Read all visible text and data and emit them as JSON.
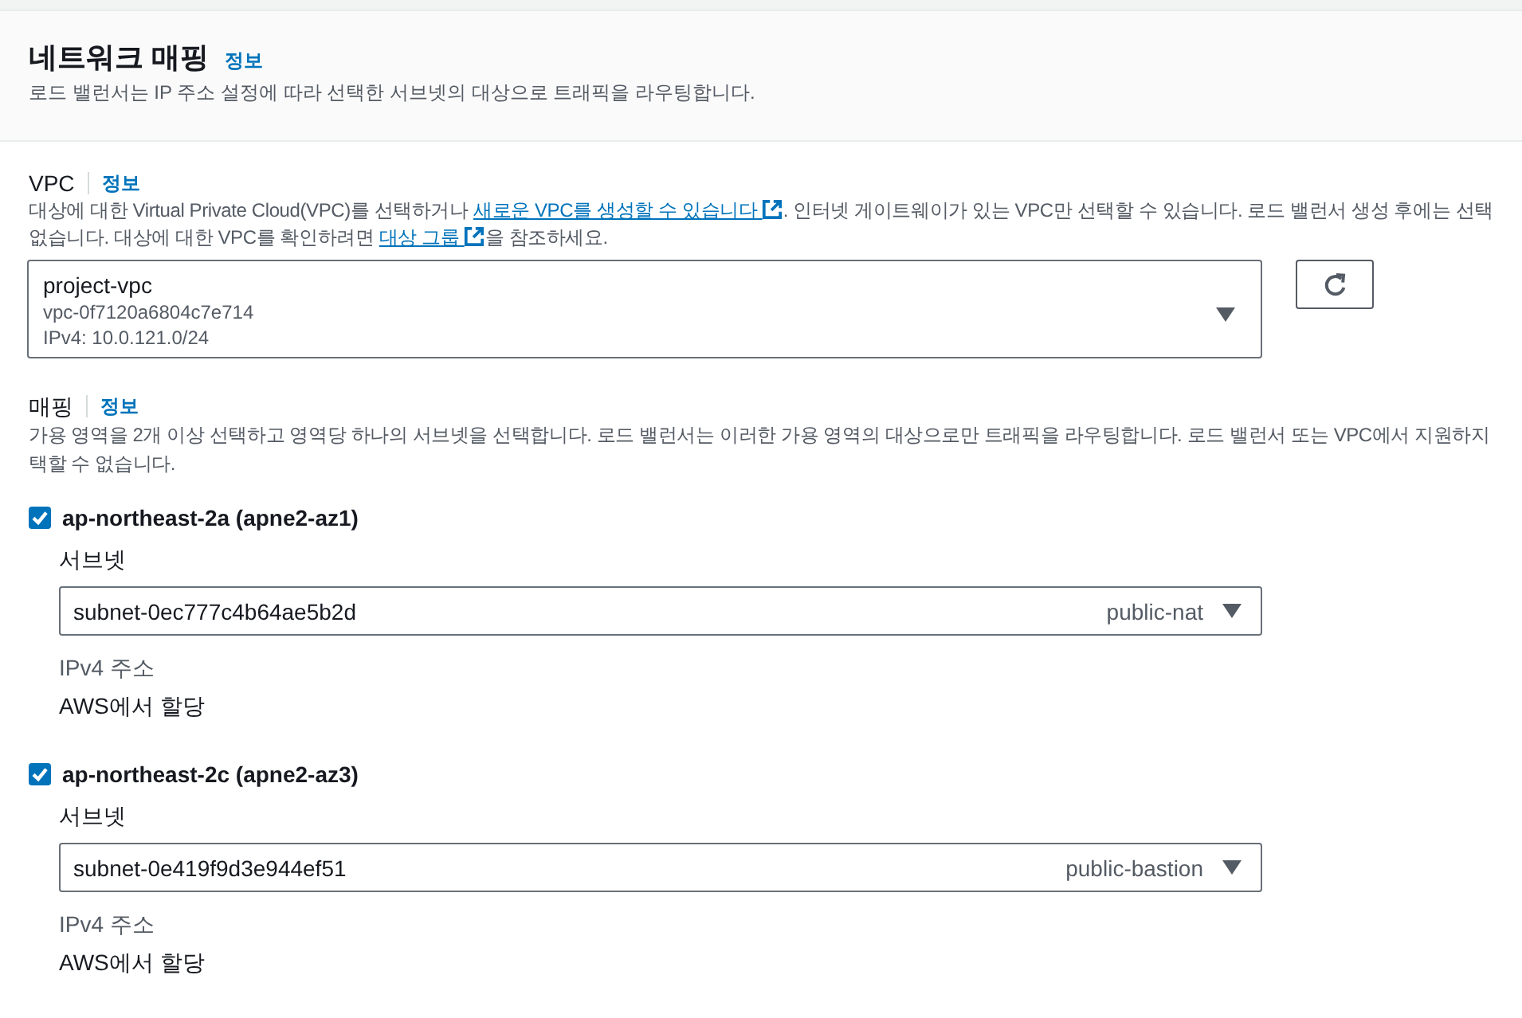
{
  "header": {
    "title": "네트워크 매핑",
    "info_link": "정보",
    "description": "로드 밸런서는 IP 주소 설정에 따라 선택한 서브넷의 대상으로 트래픽을 라우팅합니다."
  },
  "vpc": {
    "label": "VPC",
    "info_link": "정보",
    "description_lines": [
      [
        {
          "kind": "text",
          "text": "대상에 대한 Virtual Private Cloud(VPC)를 선택하거나 "
        },
        {
          "kind": "link",
          "text": "새로운 VPC를 생성할 수 있습니다"
        },
        {
          "kind": "text",
          "text": ". 인터넷 게이트웨이가 있는 VPC만 선택할 수 있습니다. 로드 밸런서 생성 후에는 선택"
        }
      ],
      [
        {
          "kind": "text",
          "text": "없습니다. 대상에 대한 VPC를 확인하려면 "
        },
        {
          "kind": "link",
          "text": "대상 그룹"
        },
        {
          "kind": "text",
          "text": "을 참조하세요."
        }
      ]
    ],
    "select": {
      "name": "project-vpc",
      "id": "vpc-0f7120a6804c7e714",
      "cidr": "IPv4: 10.0.121.0/24"
    }
  },
  "mapping": {
    "label": "매핑",
    "info_link": "정보",
    "description_lines": [
      "가용 영역을 2개 이상 선택하고 영역당 하나의 서브넷을 선택합니다. 로드 밸런서는 이러한 가용 영역의 대상으로만 트래픽을 라우팅합니다. 로드 밸런서 또는 VPC에서 지원하지",
      "택할 수 없습니다."
    ],
    "zones": [
      {
        "name": "ap-northeast-2a (apne2-az1)",
        "checked": true,
        "subnet_label": "서브넷",
        "subnet": "subnet-0ec777c4b64ae5b2d",
        "subnet_name": "public-nat",
        "ipv4_label": "IPv4 주소",
        "ipv4_value": "AWS에서 할당"
      },
      {
        "name": "ap-northeast-2c (apne2-az3)",
        "checked": true,
        "subnet_label": "서브넷",
        "subnet": "subnet-0e419f9d3e944ef51",
        "subnet_name": "public-bastion",
        "ipv4_label": "IPv4 주소",
        "ipv4_value": "AWS에서 할당"
      }
    ]
  }
}
